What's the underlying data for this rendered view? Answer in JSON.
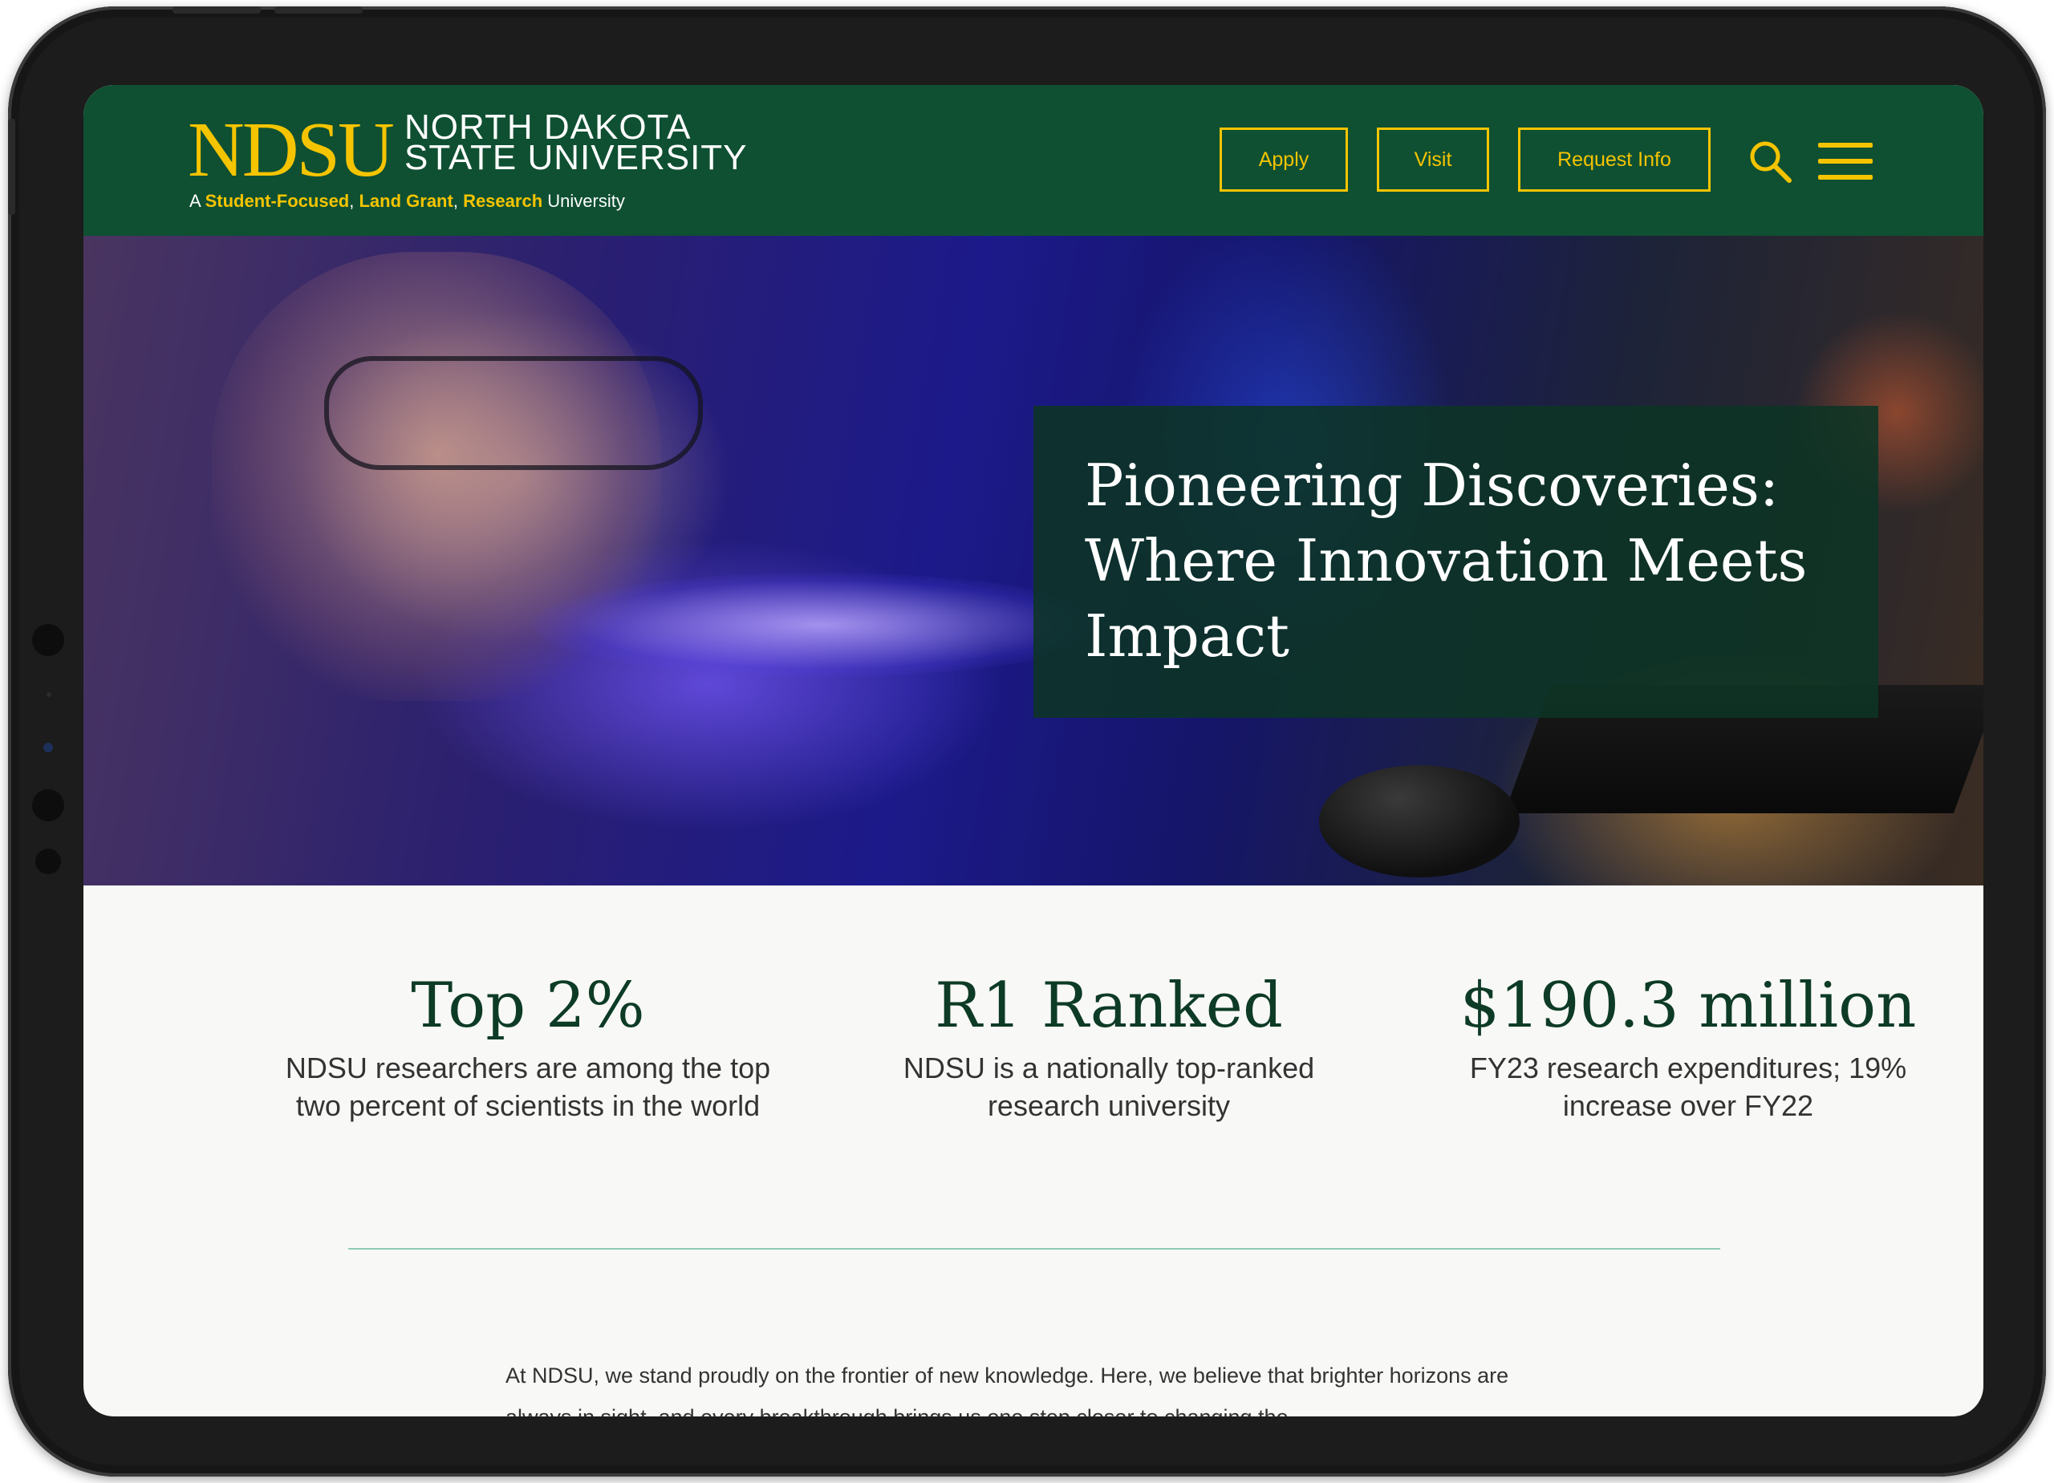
{
  "header": {
    "logo_mark": "NDSU",
    "logo_name_line1": "NORTH DAKOTA",
    "logo_name_line2": "STATE UNIVERSITY",
    "tagline": {
      "prefix": "A ",
      "part1": "Student-Focused",
      "sep1": ", ",
      "part2": "Land Grant",
      "sep2": ", ",
      "part3": "Research",
      "suffix": " University"
    },
    "buttons": {
      "apply": "Apply",
      "visit": "Visit",
      "request_info": "Request Info"
    },
    "icons": [
      "search-icon",
      "hamburger-menu-icon"
    ],
    "colors": {
      "brand_green": "#0f5032",
      "brand_gold": "#f5c400"
    }
  },
  "hero": {
    "title": "Pioneering Discoveries: Where Innovation Meets Impact"
  },
  "stats": [
    {
      "value": "Top 2%",
      "description": "NDSU researchers are among the top two percent of scientists in the world"
    },
    {
      "value": "R1 Ranked",
      "description": "NDSU is a nationally top-ranked research university"
    },
    {
      "value": "$190.3 million",
      "description": "FY23 research expenditures; 19% increase over FY22"
    }
  ],
  "intro": {
    "text": "At NDSU, we stand proudly on the frontier of new knowledge. Here, we believe that brighter horizons are always in sight, and every breakthrough brings us one step closer to changing the"
  }
}
